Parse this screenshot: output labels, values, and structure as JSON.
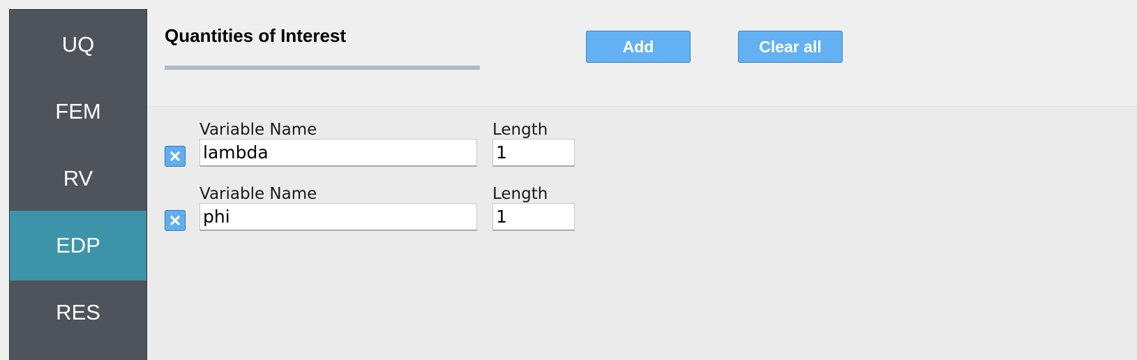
{
  "sidebar": {
    "items": [
      {
        "label": "UQ"
      },
      {
        "label": "FEM"
      },
      {
        "label": "RV"
      },
      {
        "label": "EDP"
      },
      {
        "label": "RES"
      }
    ],
    "active": "EDP"
  },
  "header": {
    "title": "Quantities of Interest",
    "add_label": "Add",
    "clear_label": "Clear all"
  },
  "rows": [
    {
      "name_label": "Variable Name",
      "name_value": "lambda",
      "length_label": "Length",
      "length_value": "1"
    },
    {
      "name_label": "Variable Name",
      "name_value": "phi",
      "length_label": "Length",
      "length_value": "1"
    }
  ],
  "colors": {
    "sidebar_bg": "#4f535b",
    "sidebar_active": "#3d94a8",
    "button_bg": "#63b1f2",
    "underline": "#afbcc4"
  },
  "icons": {
    "remove": "close-icon"
  }
}
